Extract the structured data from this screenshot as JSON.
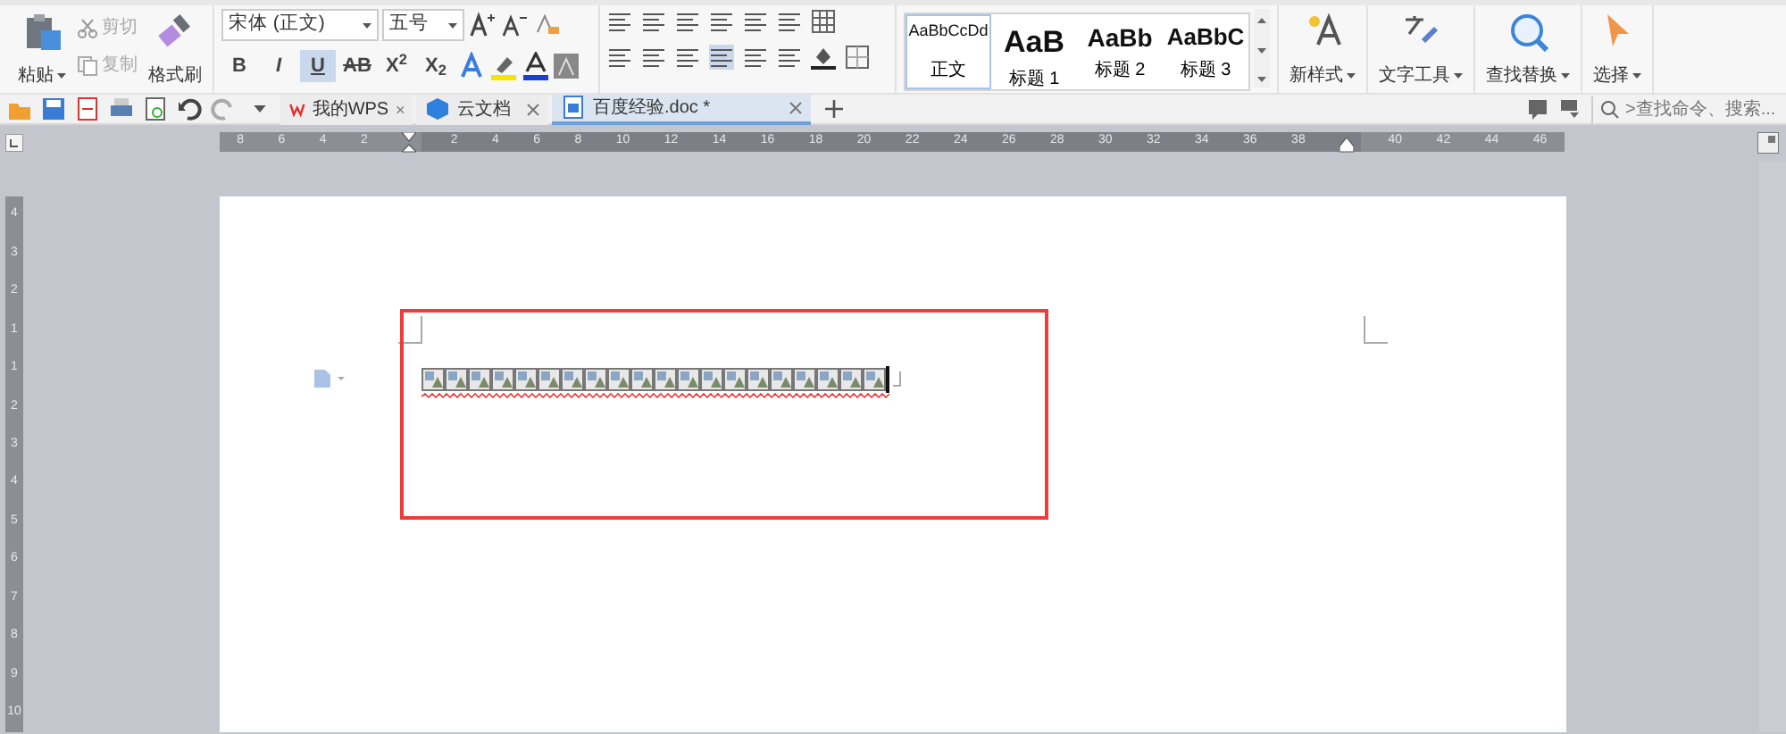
{
  "clipboard": {
    "paste": {
      "label": "粘贴"
    },
    "tools": [
      {
        "label": "剪切",
        "disabled": true
      },
      {
        "label": "复制",
        "disabled": true
      }
    ],
    "format_painter": {
      "label": "格式刷"
    }
  },
  "font": {
    "font_name": "宋体 (正文)",
    "font_size": "五号",
    "buttons": [
      {
        "label": "B",
        "selected": false
      },
      {
        "label": "I",
        "selected": false
      },
      {
        "label": "U",
        "selected": true
      },
      {
        "label": "AB",
        "selected": false
      },
      {
        "label": "X$^{2}$",
        "selected": false
      },
      {
        "label": "X$_{2}$",
        "selected": false
      }
    ]
  },
  "styles": [
    {
      "preview": "AaBbCcDd",
      "label": "正文",
      "selected": true,
      "kind": "body"
    },
    {
      "preview": "AaB",
      "label": "标题 1",
      "selected": false,
      "kind": "h1"
    },
    {
      "preview": "AaBb",
      "label": "标题 2",
      "selected": false,
      "kind": "h2"
    },
    {
      "preview": "AaBbC",
      "label": "标题 3",
      "selected": false,
      "kind": "h3"
    }
  ],
  "big_tools": [
    {
      "label": "新样式",
      "kind": "new-style"
    },
    {
      "label": "文字工具",
      "kind": "text-tools"
    },
    {
      "label": "查找替换",
      "kind": "find"
    },
    {
      "label": "选择",
      "kind": "select"
    }
  ],
  "tabs": [
    {
      "label": "我的WPS",
      "kind": "wps",
      "selected": false
    },
    {
      "label": "云文档",
      "kind": "cloud",
      "selected": false
    },
    {
      "label": "百度经验.doc *",
      "kind": "doc",
      "selected": true
    }
  ],
  "search": {
    "placeholder": ">查找命令、搜索..."
  },
  "ruler_h": [
    "8",
    "6",
    "4",
    "2",
    "2",
    "4",
    "6",
    "8",
    "10",
    "12",
    "14",
    "16",
    "18",
    "20",
    "22",
    "24",
    "26",
    "28",
    "30",
    "32",
    "34",
    "36",
    "38",
    "40",
    "42",
    "44",
    "46"
  ],
  "ruler_v": [
    "4",
    "3",
    "2",
    "1",
    "1",
    "2",
    "3",
    "4",
    "5",
    "6",
    "7",
    "8",
    "9",
    "10"
  ],
  "document": {
    "content": [
      {
        "kind": "image"
      },
      {
        "kind": "image"
      },
      {
        "kind": "image"
      },
      {
        "kind": "image"
      },
      {
        "kind": "image"
      },
      {
        "kind": "image"
      },
      {
        "kind": "image"
      },
      {
        "kind": "image"
      },
      {
        "kind": "image"
      },
      {
        "kind": "image"
      },
      {
        "kind": "image"
      },
      {
        "kind": "image"
      },
      {
        "kind": "image"
      },
      {
        "kind": "image"
      },
      {
        "kind": "image"
      },
      {
        "kind": "image"
      },
      {
        "kind": "image"
      },
      {
        "kind": "image"
      },
      {
        "kind": "image"
      },
      {
        "kind": "image"
      }
    ],
    "spellcheck_error": true,
    "highlight_box": true
  }
}
